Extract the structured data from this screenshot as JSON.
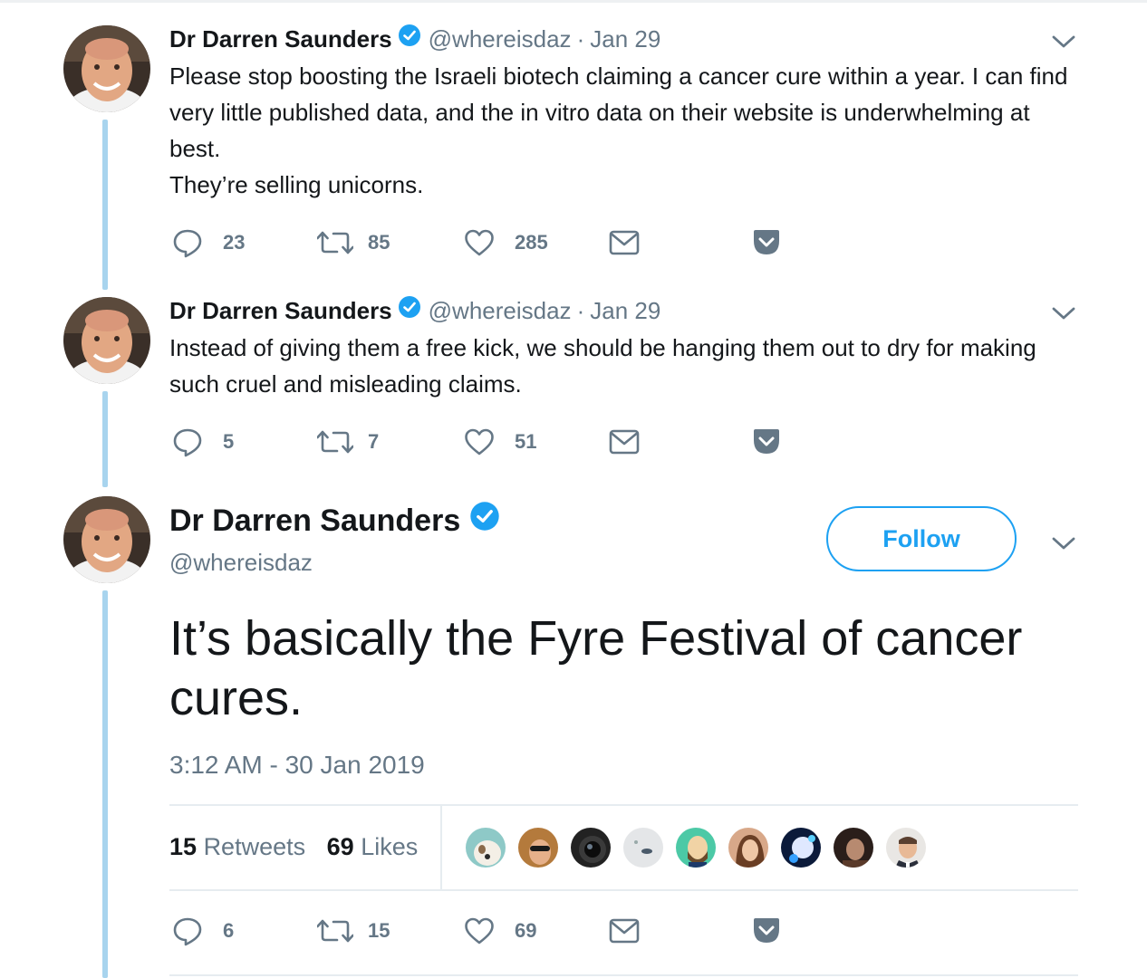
{
  "author": {
    "name": "Dr Darren Saunders",
    "handle": "@whereisdaz",
    "verified": true
  },
  "tweets": [
    {
      "date": "Jan 29",
      "text": "Please stop boosting the Israeli biotech claiming a cancer cure within a year. I can find very little published data, and the in vitro data on their website is underwhelming at best.\nThey’re selling unicorns.",
      "replies": "23",
      "retweets": "85",
      "likes": "285"
    },
    {
      "date": "Jan 29",
      "text": "Instead of giving them a free kick, we should be hanging them out to dry for making such cruel and misleading claims.",
      "replies": "5",
      "retweets": "7",
      "likes": "51"
    }
  ],
  "main_tweet": {
    "follow_label": "Follow",
    "text": "It’s basically the Fyre Festival of cancer cures.",
    "timestamp": "3:12 AM - 30 Jan 2019",
    "retweet_count": "15",
    "retweet_label": "Retweets",
    "like_count": "69",
    "like_label": "Likes",
    "replies": "6",
    "retweets": "15",
    "likes": "69"
  },
  "colors": {
    "accent": "#1da1f2",
    "muted": "#657786",
    "thread": "#a8d4ee"
  },
  "icons": [
    "reply-icon",
    "retweet-icon",
    "like-icon",
    "dm-icon",
    "pocket-icon",
    "chevron-down-icon",
    "verified-icon"
  ]
}
